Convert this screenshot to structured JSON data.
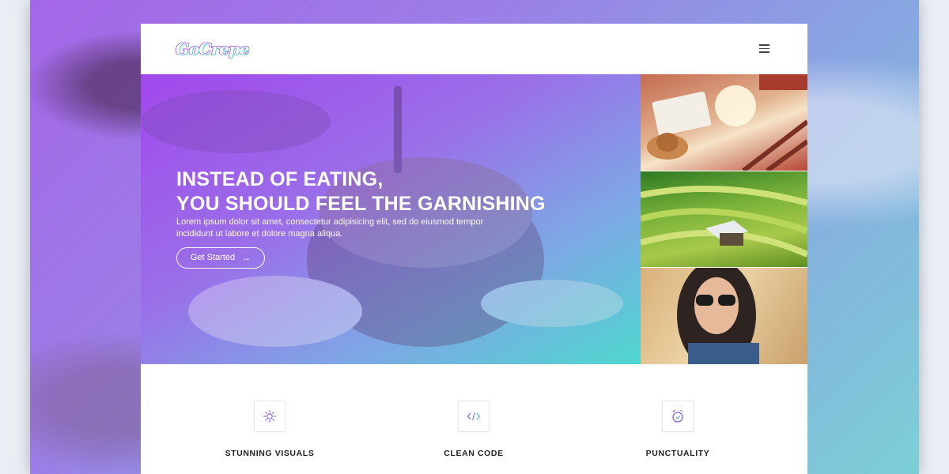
{
  "header": {
    "logo_text": "GoCrepe",
    "menu_icon": "hamburger-menu-icon"
  },
  "hero": {
    "title_line1": "INSTEAD OF EATING,",
    "title_line2": "YOU SHOULD FEEL THE GARNISHING",
    "text": "Lorem ipsum dolor sit amet, consectetur adipisicing elit, sed do eiusmod tempor incididunt ut labore et dolore magna aliqua.",
    "cta_label": "Get Started",
    "cta_icon": "arrow-right-icon"
  },
  "side_images": [
    {
      "name": "travel-map-photo"
    },
    {
      "name": "rice-terraces-photo"
    },
    {
      "name": "woman-sunglasses-photo"
    }
  ],
  "features": [
    {
      "title": "STUNNING VISUALS",
      "icon": "sun-icon"
    },
    {
      "title": "CLEAN CODE",
      "icon": "code-icon"
    },
    {
      "title": "PUNCTUALITY",
      "icon": "alarm-clock-icon"
    }
  ],
  "colors": {
    "gradient_start": "#a148ec",
    "gradient_end": "#4fd7cf",
    "accent_purple": "#a74ae8",
    "accent_teal": "#5fd3d7"
  }
}
